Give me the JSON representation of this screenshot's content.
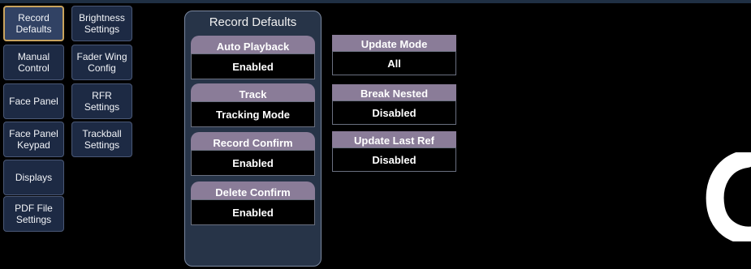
{
  "nav": [
    {
      "label": "Record\nDefaults",
      "active": true
    },
    {
      "label": "Brightness\nSettings"
    },
    {
      "label": "Manual\nControl"
    },
    {
      "label": "Fader Wing\nConfig"
    },
    {
      "label": "Face Panel"
    },
    {
      "label": "RFR\nSettings"
    },
    {
      "label": "Face Panel\nKeypad"
    },
    {
      "label": "Trackball\nSettings"
    },
    {
      "label": "Displays"
    },
    {
      "label": "PDF File\nSettings"
    }
  ],
  "panel": {
    "title": "Record Defaults",
    "settings": [
      {
        "label": "Auto Playback",
        "value": "Enabled"
      },
      {
        "label": "Track",
        "value": "Tracking Mode"
      },
      {
        "label": "Record Confirm",
        "value": "Enabled"
      },
      {
        "label": "Delete Confirm",
        "value": "Enabled"
      }
    ]
  },
  "right_settings": [
    {
      "label": "Update Mode",
      "value": "All"
    },
    {
      "label": "Break Nested",
      "value": "Disabled"
    },
    {
      "label": "Update Last Ref",
      "value": "Disabled"
    }
  ]
}
